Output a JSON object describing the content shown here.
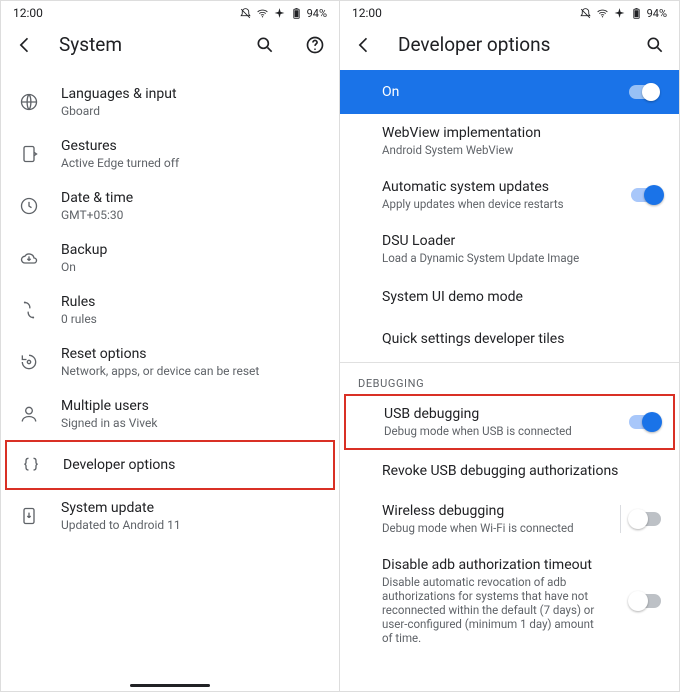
{
  "status": {
    "time": "12:00",
    "battery_pct": "94%"
  },
  "left": {
    "title": "System",
    "items": [
      {
        "icon": "globe-icon",
        "title": "Languages & input",
        "sub": "Gboard"
      },
      {
        "icon": "gestures-icon",
        "title": "Gestures",
        "sub": "Active Edge turned off"
      },
      {
        "icon": "clock-icon",
        "title": "Date & time",
        "sub": "GMT+05:30"
      },
      {
        "icon": "cloud-icon",
        "title": "Backup",
        "sub": "On"
      },
      {
        "icon": "rules-icon",
        "title": "Rules",
        "sub": "0 rules"
      },
      {
        "icon": "reset-icon",
        "title": "Reset options",
        "sub": "Network, apps, or device can be reset"
      },
      {
        "icon": "person-icon",
        "title": "Multiple users",
        "sub": "Signed in as Vivek"
      },
      {
        "icon": "braces-icon",
        "title": "Developer options",
        "sub": ""
      },
      {
        "icon": "update-icon",
        "title": "System update",
        "sub": "Updated to Android 11"
      }
    ]
  },
  "right": {
    "title": "Developer options",
    "master_label": "On",
    "items": [
      {
        "title": "WebView implementation",
        "sub": "Android System WebView",
        "switch": null
      },
      {
        "title": "Automatic system updates",
        "sub": "Apply updates when device restarts",
        "switch": "on"
      },
      {
        "title": "DSU Loader",
        "sub": "Load a Dynamic System Update Image",
        "switch": null
      },
      {
        "title": "System UI demo mode",
        "sub": "",
        "switch": null
      },
      {
        "title": "Quick settings developer tiles",
        "sub": "",
        "switch": null
      }
    ],
    "section_label": "DEBUGGING",
    "debug_items": [
      {
        "title": "USB debugging",
        "sub": "Debug mode when USB is connected",
        "switch": "on"
      },
      {
        "title": "Revoke USB debugging authorizations",
        "sub": "",
        "switch": null
      },
      {
        "title": "Wireless debugging",
        "sub": "Debug mode when Wi-Fi is connected",
        "switch": "off",
        "divider": true
      },
      {
        "title": "Disable adb authorization timeout",
        "sub": "Disable automatic revocation of adb authorizations for systems that have not reconnected within the default (7 days) or user-configured (minimum 1 day) amount of time.",
        "switch": "off"
      }
    ]
  }
}
